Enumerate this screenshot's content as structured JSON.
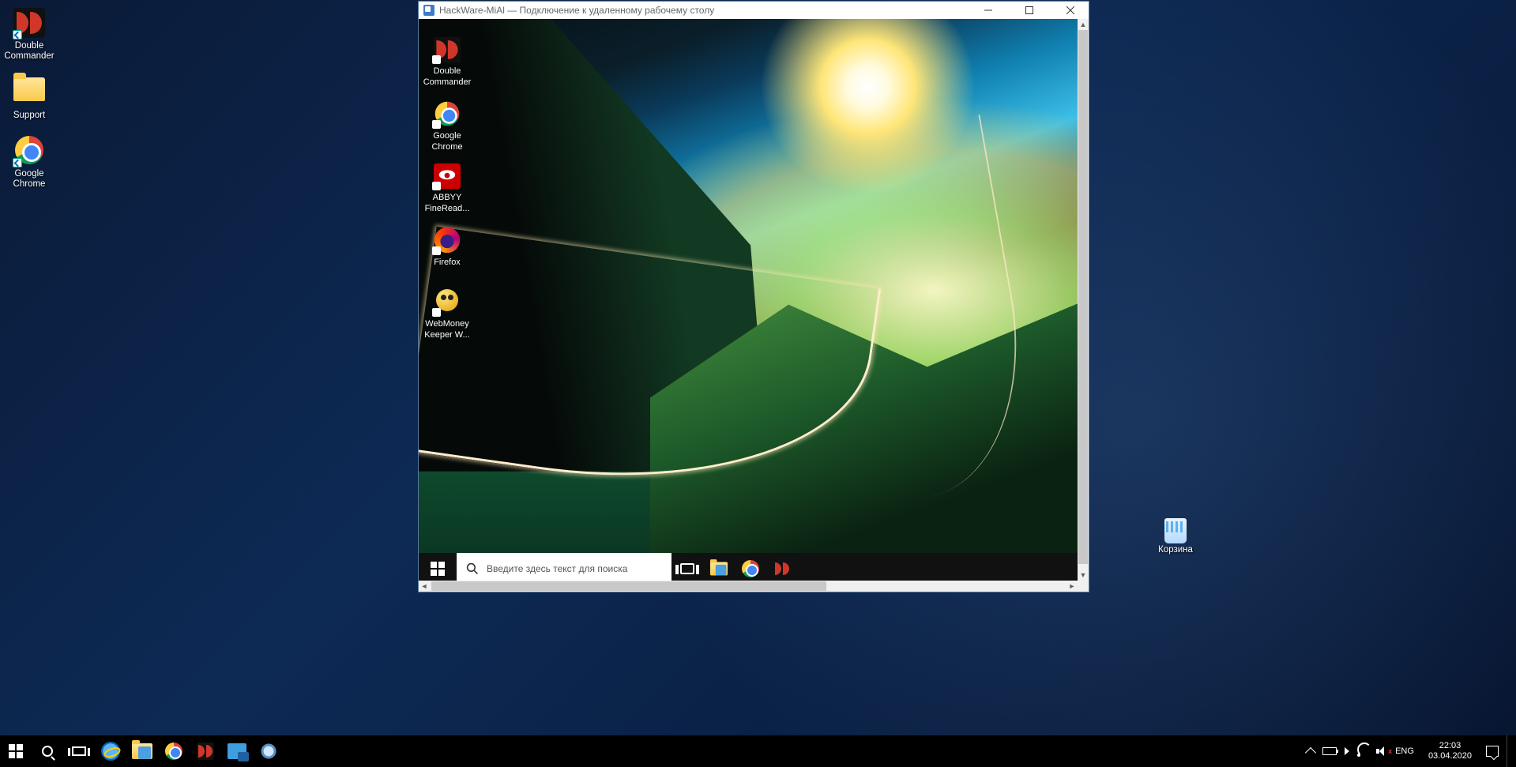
{
  "host": {
    "desktop_icons": [
      {
        "name": "double-commander",
        "label": "Double Commander"
      },
      {
        "name": "support-folder",
        "label": "Support"
      },
      {
        "name": "google-chrome",
        "label": "Google Chrome"
      }
    ],
    "recycle_bin_label": "Корзина",
    "taskbar": {
      "tray": {
        "language": "ENG",
        "time": "22:03",
        "date": "03.04.2020"
      }
    }
  },
  "rdp": {
    "title": "HackWare-MiAl — Подключение к удаленному рабочему столу",
    "remote_desktop_icons": [
      {
        "name": "double-commander",
        "label": "Double Commander"
      },
      {
        "name": "google-chrome",
        "label": "Google Chrome"
      },
      {
        "name": "abbyy-finereader",
        "label": "ABBYY FineRead..."
      },
      {
        "name": "firefox",
        "label": "Firefox"
      },
      {
        "name": "webmoney-keeper",
        "label": "WebMoney Keeper W..."
      }
    ],
    "remote_taskbar": {
      "search_placeholder": "Введите здесь текст для поиска"
    }
  }
}
